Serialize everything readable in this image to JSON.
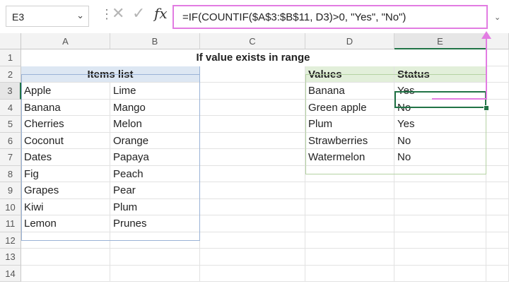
{
  "formula_bar": {
    "name_box": "E3",
    "name_box_dropdown": "⌄",
    "separator": "⋮",
    "cancel_icon": "✕",
    "enter_icon": "✓",
    "fx_label": "fx",
    "formula": "=IF(COUNTIF($A$3:$B$11, D3)>0, \"Yes\", \"No\")",
    "expand_icon": "⌄"
  },
  "columns": [
    "A",
    "B",
    "C",
    "D",
    "E"
  ],
  "rows": [
    "1",
    "2",
    "3",
    "4",
    "5",
    "6",
    "7",
    "8",
    "9",
    "10",
    "11",
    "12",
    "13",
    "14"
  ],
  "title": "If value exists in range",
  "items_list": {
    "header": "Items list",
    "col_a": [
      "Apple",
      "Banana",
      "Cherries",
      "Coconut",
      "Dates",
      "Fig",
      "Grapes",
      "Kiwi",
      "Lemon"
    ],
    "col_b": [
      "Lime",
      "Mango",
      "Melon",
      "Orange",
      "Papaya",
      "Peach",
      "Pear",
      "Plum",
      "Prunes"
    ]
  },
  "lookup": {
    "values_header": "Values",
    "status_header": "Status",
    "values": [
      "Banana",
      "Green apple",
      "Plum",
      "Strawberries",
      "Watermelon"
    ],
    "status": [
      "Yes",
      "No",
      "Yes",
      "No",
      "No"
    ]
  },
  "colors": {
    "accent_pink": "#e27ce2",
    "excel_green": "#217346",
    "blue_header": "#dde7f3",
    "green_header": "#e2efda"
  }
}
